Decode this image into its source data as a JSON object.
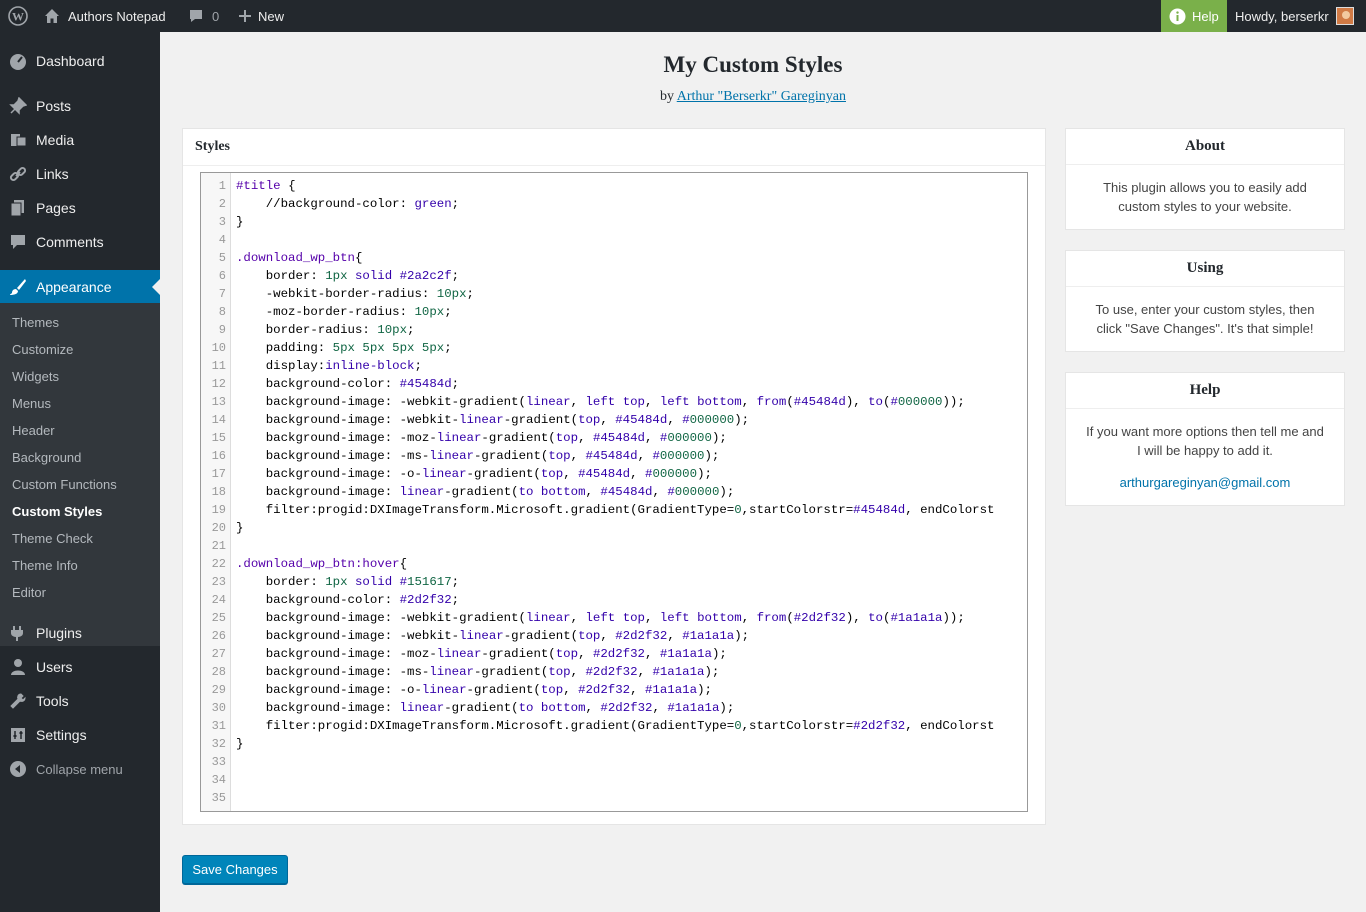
{
  "adminbar": {
    "site_name": "Authors Notepad",
    "comments_count": "0",
    "new_label": "New",
    "help_label": "Help",
    "howdy": "Howdy, berserkr"
  },
  "sidebar": {
    "items": [
      {
        "label": "Dashboard",
        "icon": "dashboard-icon"
      },
      {
        "label": "Posts",
        "icon": "pushpin-icon"
      },
      {
        "label": "Media",
        "icon": "media-icon"
      },
      {
        "label": "Links",
        "icon": "link-icon"
      },
      {
        "label": "Pages",
        "icon": "pages-icon"
      },
      {
        "label": "Comments",
        "icon": "comment-icon"
      },
      {
        "label": "Appearance",
        "icon": "paintbrush-icon"
      },
      {
        "label": "Plugins",
        "icon": "plug-icon"
      },
      {
        "label": "Users",
        "icon": "user-icon"
      },
      {
        "label": "Tools",
        "icon": "wrench-icon"
      },
      {
        "label": "Settings",
        "icon": "settings-icon"
      }
    ],
    "submenu": [
      "Themes",
      "Customize",
      "Widgets",
      "Menus",
      "Header",
      "Background",
      "Custom Functions",
      "Custom Styles",
      "Theme Check",
      "Theme Info",
      "Editor"
    ],
    "collapse_label": "Collapse menu"
  },
  "main": {
    "title": "My Custom Styles",
    "byline_prefix": "by",
    "author": "Arthur \"Berserkr\" Gareginyan",
    "styles_heading": "Styles",
    "code_lines": [
      "#title {",
      "    //background-color: green;",
      "}",
      "",
      ".download_wp_btn{",
      "    border: 1px solid #2a2c2f;",
      "    -webkit-border-radius: 10px;",
      "    -moz-border-radius: 10px;",
      "    border-radius: 10px;",
      "    padding: 5px 5px 5px 5px;",
      "    display:inline-block;",
      "    background-color: #45484d;",
      "    background-image: -webkit-gradient(linear, left top, left bottom, from(#45484d), to(#000000));",
      "    background-image: -webkit-linear-gradient(top, #45484d, #000000);",
      "    background-image: -moz-linear-gradient(top, #45484d, #000000);",
      "    background-image: -ms-linear-gradient(top, #45484d, #000000);",
      "    background-image: -o-linear-gradient(top, #45484d, #000000);",
      "    background-image: linear-gradient(to bottom, #45484d, #000000);",
      "    filter:progid:DXImageTransform.Microsoft.gradient(GradientType=0,startColorstr=#45484d, endColorst",
      "}",
      "",
      ".download_wp_btn:hover{",
      "    border: 1px solid #151617;",
      "    background-color: #2d2f32;",
      "    background-image: -webkit-gradient(linear, left top, left bottom, from(#2d2f32), to(#1a1a1a));",
      "    background-image: -webkit-linear-gradient(top, #2d2f32, #1a1a1a);",
      "    background-image: -moz-linear-gradient(top, #2d2f32, #1a1a1a);",
      "    background-image: -ms-linear-gradient(top, #2d2f32, #1a1a1a);",
      "    background-image: -o-linear-gradient(top, #2d2f32, #1a1a1a);",
      "    background-image: linear-gradient(to bottom, #2d2f32, #1a1a1a);",
      "    filter:progid:DXImageTransform.Microsoft.gradient(GradientType=0,startColorstr=#2d2f32, endColorst",
      "}",
      "",
      "",
      ""
    ],
    "save_label": "Save Changes"
  },
  "about": {
    "title": "About",
    "text": "This plugin allows you to easily add custom styles to your website."
  },
  "using": {
    "title": "Using",
    "text": "To use, enter your custom styles, then click \"Save Changes\". It's that simple!"
  },
  "help": {
    "title": "Help",
    "text": "If you want more options then tell me and I will be happy to add it.",
    "email": "arthurgareginyan@gmail.com"
  },
  "colors": {
    "adminbar_bg": "#23282d",
    "menu_active": "#0073aa",
    "help_green": "#7ab04a",
    "button_blue": "#0085ba"
  }
}
